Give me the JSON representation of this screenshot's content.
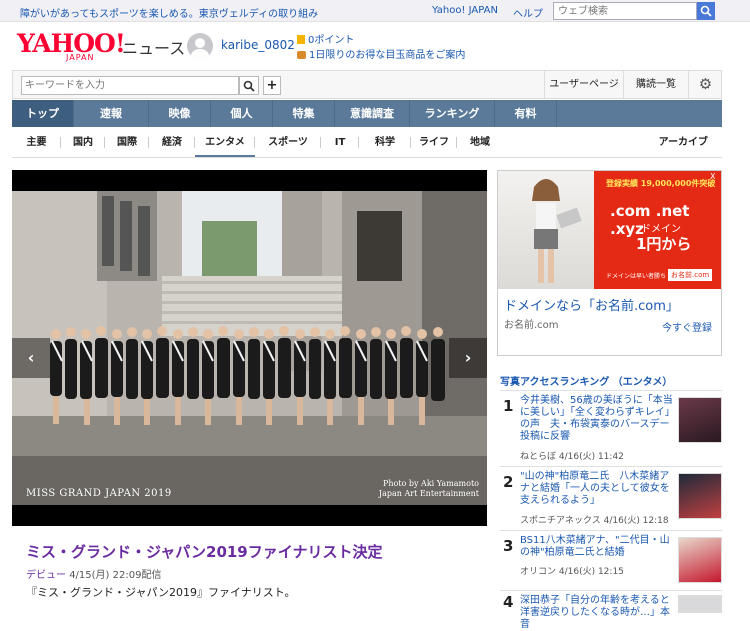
{
  "topbar": {
    "promo": "障がいがあってもスポーツを楽しめる。東京ヴェルディの取り組み",
    "yahoo_japan": "Yahoo! JAPAN",
    "help": "ヘルプ",
    "search_placeholder": "ウェブ検索"
  },
  "brand": {
    "logo": "YAHOO!",
    "logo_sub": "JAPAN",
    "news": "ニュース"
  },
  "user": {
    "name": "karibe_0802",
    "points": "0ポイント",
    "daily_deal": "1日限りのお得な目玉商品をご案内"
  },
  "toolbar": {
    "keyword_placeholder": "キーワードを入力",
    "plus": "+",
    "user_page": "ユーザーページ",
    "subscriptions": "購読一覧"
  },
  "main_nav": [
    "トップ",
    "速報",
    "映像",
    "個人",
    "特集",
    "意識調査",
    "ランキング",
    "有料"
  ],
  "sub_nav": [
    "主要",
    "国内",
    "国際",
    "経済",
    "エンタメ",
    "スポーツ",
    "IT",
    "科学",
    "ライフ",
    "地域"
  ],
  "archive": "アーカイブ",
  "photo": {
    "prev": "‹",
    "next": "›",
    "credit_line1": "Photo by Aki Yamamoto",
    "credit_line2": "Japan Art Entertainment",
    "pageant": "MISS GRAND JAPAN 2019"
  },
  "article": {
    "headline": "ミス・グランド・ジャパン2019ファイナリスト決定",
    "source": "デビュー",
    "date": "4/15(月) 22:09配信",
    "lead": "『ミス・グランド・ジャパン2019』ファイナリスト。"
  },
  "ad": {
    "price_badge": "登録実績 19,000,000件突破",
    "tld": ".com .net .xyz",
    "domain_label": "ドメイン",
    "yen": "1円から",
    "note": "ドメインは早い者勝ち",
    "brand": "お名前.com",
    "x": "X",
    "title": "ドメインなら「お名前.com」",
    "url": "お名前.com",
    "cta": "今すぐ登録"
  },
  "ranking": {
    "heading": "写真アクセスランキング （エンタメ）",
    "items": [
      {
        "num": "1",
        "title": "今井美樹、56歳の美ぼうに「本当に美しい」「全く変わらずキレイ」の声　夫・布袋寅泰のバースデー投稿に反響",
        "meta": "ねとらぼ 4/16(火) 11:42"
      },
      {
        "num": "2",
        "title": "\"山の神\"柏原竜二氏　八木菜緒アナと結婚「一人の夫として彼女を支えられるよう」",
        "meta": "スポニチアネックス 4/16(火) 12:18"
      },
      {
        "num": "3",
        "title": "BS11八木菜緒アナ、\"二代目・山の神\"柏原竜二氏と結婚",
        "meta": "オリコン 4/16(火) 12:15"
      },
      {
        "num": "4",
        "title": "深田恭子「自分の年齢を考えると洋害逆戻りしたくなる時が…」本音",
        "meta": ""
      }
    ]
  },
  "colors": {
    "nav": "#5b7a9a",
    "link": "#1a58b0",
    "headline": "#6a2ba0",
    "brand_red": "#ff0033"
  }
}
